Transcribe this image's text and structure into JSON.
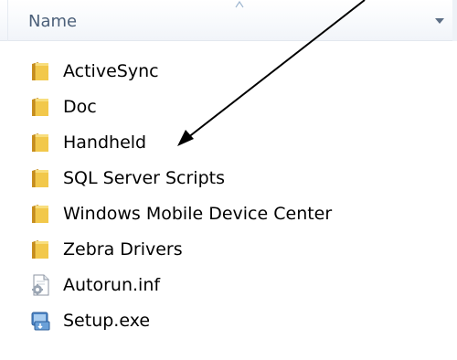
{
  "header": {
    "column_name_label": "Name"
  },
  "files": [
    {
      "name": "ActiveSync",
      "icon": "folder-icon"
    },
    {
      "name": "Doc",
      "icon": "folder-icon"
    },
    {
      "name": "Handheld",
      "icon": "folder-icon"
    },
    {
      "name": "SQL Server Scripts",
      "icon": "folder-icon"
    },
    {
      "name": "Windows Mobile Device Center",
      "icon": "folder-icon"
    },
    {
      "name": "Zebra Drivers",
      "icon": "folder-icon"
    },
    {
      "name": "Autorun.inf",
      "icon": "settings-file-icon"
    },
    {
      "name": "Setup.exe",
      "icon": "installer-icon"
    }
  ],
  "colors": {
    "header_text": "#4c607a",
    "folder": "#e9b93a",
    "arrow": "#000000"
  }
}
